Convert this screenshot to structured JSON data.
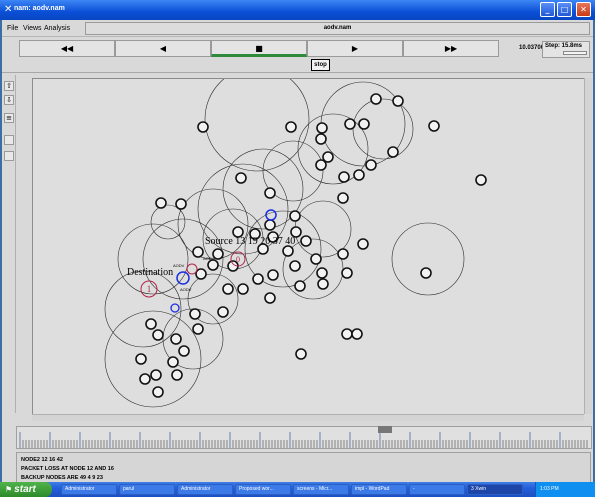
{
  "window": {
    "title": "nam: aodv.nam"
  },
  "menubar": {
    "items": [
      "File",
      "Views",
      "Analysis"
    ],
    "trace_file": "aodv.nam"
  },
  "controls": {
    "rewind": "◀◀",
    "back": "◀",
    "stop": "■",
    "play": "▶",
    "fast_forward": "▶▶",
    "stop_tooltip": "stop",
    "time": "10.037000",
    "step": "Step: 15.8ms"
  },
  "topology": {
    "source_label": "Source 13 19 20 37 40",
    "destination_label": "Destination",
    "destination_node": "1",
    "source_node": "0",
    "packet_labels": [
      "AODV",
      "AODV",
      "AODV"
    ]
  },
  "log": {
    "lines": [
      "NODE2 12 16 42",
      "PACKET LOSS AT NODE 12 AND 16",
      "BACKUP NODES ARE 49 4 9 23"
    ]
  },
  "taskbar": {
    "start": "start",
    "tasks": [
      "Administrator",
      "parul",
      "Administrator",
      "Proposed wor...",
      "screens - Micr...",
      "impl - WordPad",
      "-",
      "3 Xwin"
    ],
    "clock": "1:03 PM"
  },
  "colors": {
    "node_ring": "#222222",
    "source_ring": "#b0264a",
    "sender_node": "#1a2ee0",
    "canvas_bg": "#dedede"
  }
}
